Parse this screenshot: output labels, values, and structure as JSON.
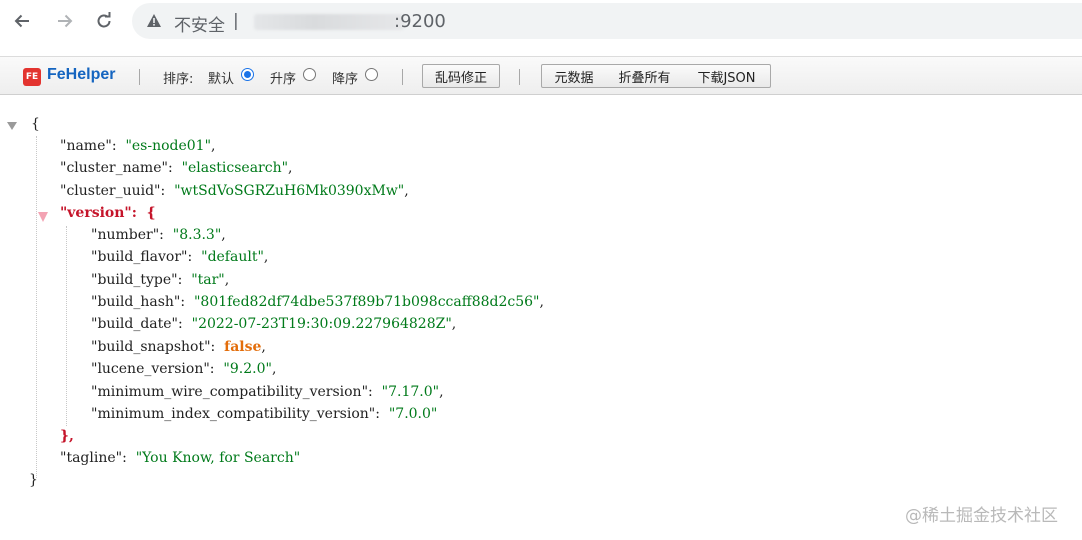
{
  "browser": {
    "security_label": "不安全",
    "separator": "|",
    "url_visible": ":9200",
    "icons": {
      "back": "arrow-left-icon",
      "forward": "arrow-right-icon",
      "reload": "reload-icon",
      "warning": "warning-triangle-icon"
    }
  },
  "toolbar": {
    "logo_text": "FE",
    "title": "FeHelper",
    "sort_label": "排序:",
    "sort_options": [
      {
        "label": "默认",
        "checked": true
      },
      {
        "label": "升序",
        "checked": false
      },
      {
        "label": "降序",
        "checked": false
      }
    ],
    "fix_encoding_label": "乱码修正",
    "metadata_label": "元数据",
    "collapse_all_label": "折叠所有",
    "download_label": "下载JSON"
  },
  "json": {
    "open_brace": "{",
    "close_brace": "}",
    "fields": [
      {
        "key": "\"name\"",
        "value": "\"es-node01\"",
        "comma": ","
      },
      {
        "key": "\"cluster_name\"",
        "value": "\"elasticsearch\"",
        "comma": ","
      },
      {
        "key": "\"cluster_uuid\"",
        "value": "\"wtSdVoSGRZuH6Mk0390xMw\"",
        "comma": ","
      }
    ],
    "version": {
      "key": "\"version\"",
      "open": "{",
      "close": "},",
      "fields": [
        {
          "key": "\"number\"",
          "value": "\"8.3.3\"",
          "comma": ",",
          "type": "string"
        },
        {
          "key": "\"build_flavor\"",
          "value": "\"default\"",
          "comma": ",",
          "type": "string"
        },
        {
          "key": "\"build_type\"",
          "value": "\"tar\"",
          "comma": ",",
          "type": "string"
        },
        {
          "key": "\"build_hash\"",
          "value": "\"801fed82df74dbe537f89b71b098ccaff88d2c56\"",
          "comma": ",",
          "type": "string"
        },
        {
          "key": "\"build_date\"",
          "value": "\"2022-07-23T19:30:09.227964828Z\"",
          "comma": ",",
          "type": "string"
        },
        {
          "key": "\"build_snapshot\"",
          "value": "false",
          "comma": ",",
          "type": "bool"
        },
        {
          "key": "\"lucene_version\"",
          "value": "\"9.2.0\"",
          "comma": ",",
          "type": "string"
        },
        {
          "key": "\"minimum_wire_compatibility_version\"",
          "value": "\"7.17.0\"",
          "comma": ",",
          "type": "string"
        },
        {
          "key": "\"minimum_index_compatibility_version\"",
          "value": "\"7.0.0\"",
          "comma": "",
          "type": "string"
        }
      ]
    },
    "tagline": {
      "key": "\"tagline\"",
      "value": "\"You Know, for Search\""
    }
  },
  "watermark": "@稀土掘金技术社区",
  "colors": {
    "string": "#007a1a",
    "bool": "#e36d0a",
    "highlight_key": "#c5142a",
    "fehelper_blue": "#1565c0"
  }
}
